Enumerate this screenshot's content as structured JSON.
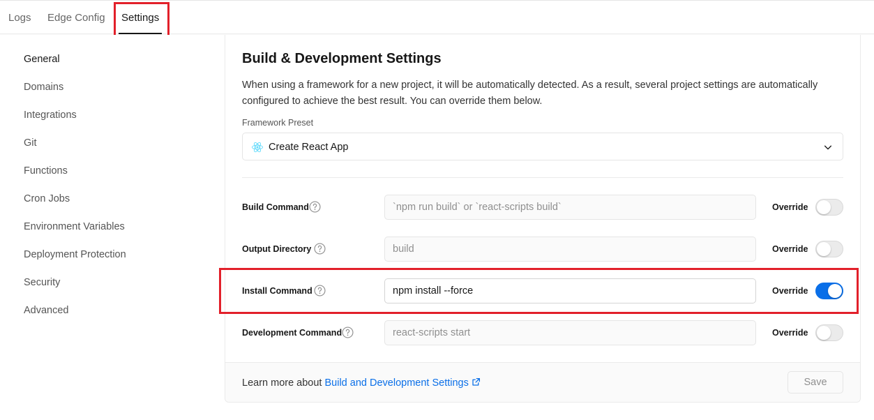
{
  "tabs": {
    "logs": "Logs",
    "edge_config": "Edge Config",
    "settings": "Settings"
  },
  "sidebar": {
    "items": [
      {
        "label": "General",
        "active": true
      },
      {
        "label": "Domains"
      },
      {
        "label": "Integrations"
      },
      {
        "label": "Git"
      },
      {
        "label": "Functions"
      },
      {
        "label": "Cron Jobs"
      },
      {
        "label": "Environment Variables"
      },
      {
        "label": "Deployment Protection"
      },
      {
        "label": "Security"
      },
      {
        "label": "Advanced"
      }
    ]
  },
  "card": {
    "title": "Build & Development Settings",
    "description": "When using a framework for a new project, it will be automatically detected. As a result, several project settings are automatically configured to achieve the best result. You can override them below.",
    "preset_label": "Framework Preset",
    "preset_value": "Create React App",
    "preset_icon": "react-icon",
    "rows": [
      {
        "label": "Build Command",
        "value": "`npm run build` or `react-scripts build`",
        "override_label": "Override",
        "override_on": false
      },
      {
        "label": "Output Directory",
        "value": "build",
        "override_label": "Override",
        "override_on": false
      },
      {
        "label": "Install Command",
        "value": "npm install --force",
        "override_label": "Override",
        "override_on": true
      },
      {
        "label": "Development Command",
        "value": "react-scripts start",
        "override_label": "Override",
        "override_on": false
      }
    ],
    "footer": {
      "learn_prefix": "Learn more about ",
      "learn_link": "Build and Development Settings",
      "save_label": "Save"
    }
  },
  "colors": {
    "accent": "#0a6fe8",
    "highlight": "#e2202a"
  }
}
